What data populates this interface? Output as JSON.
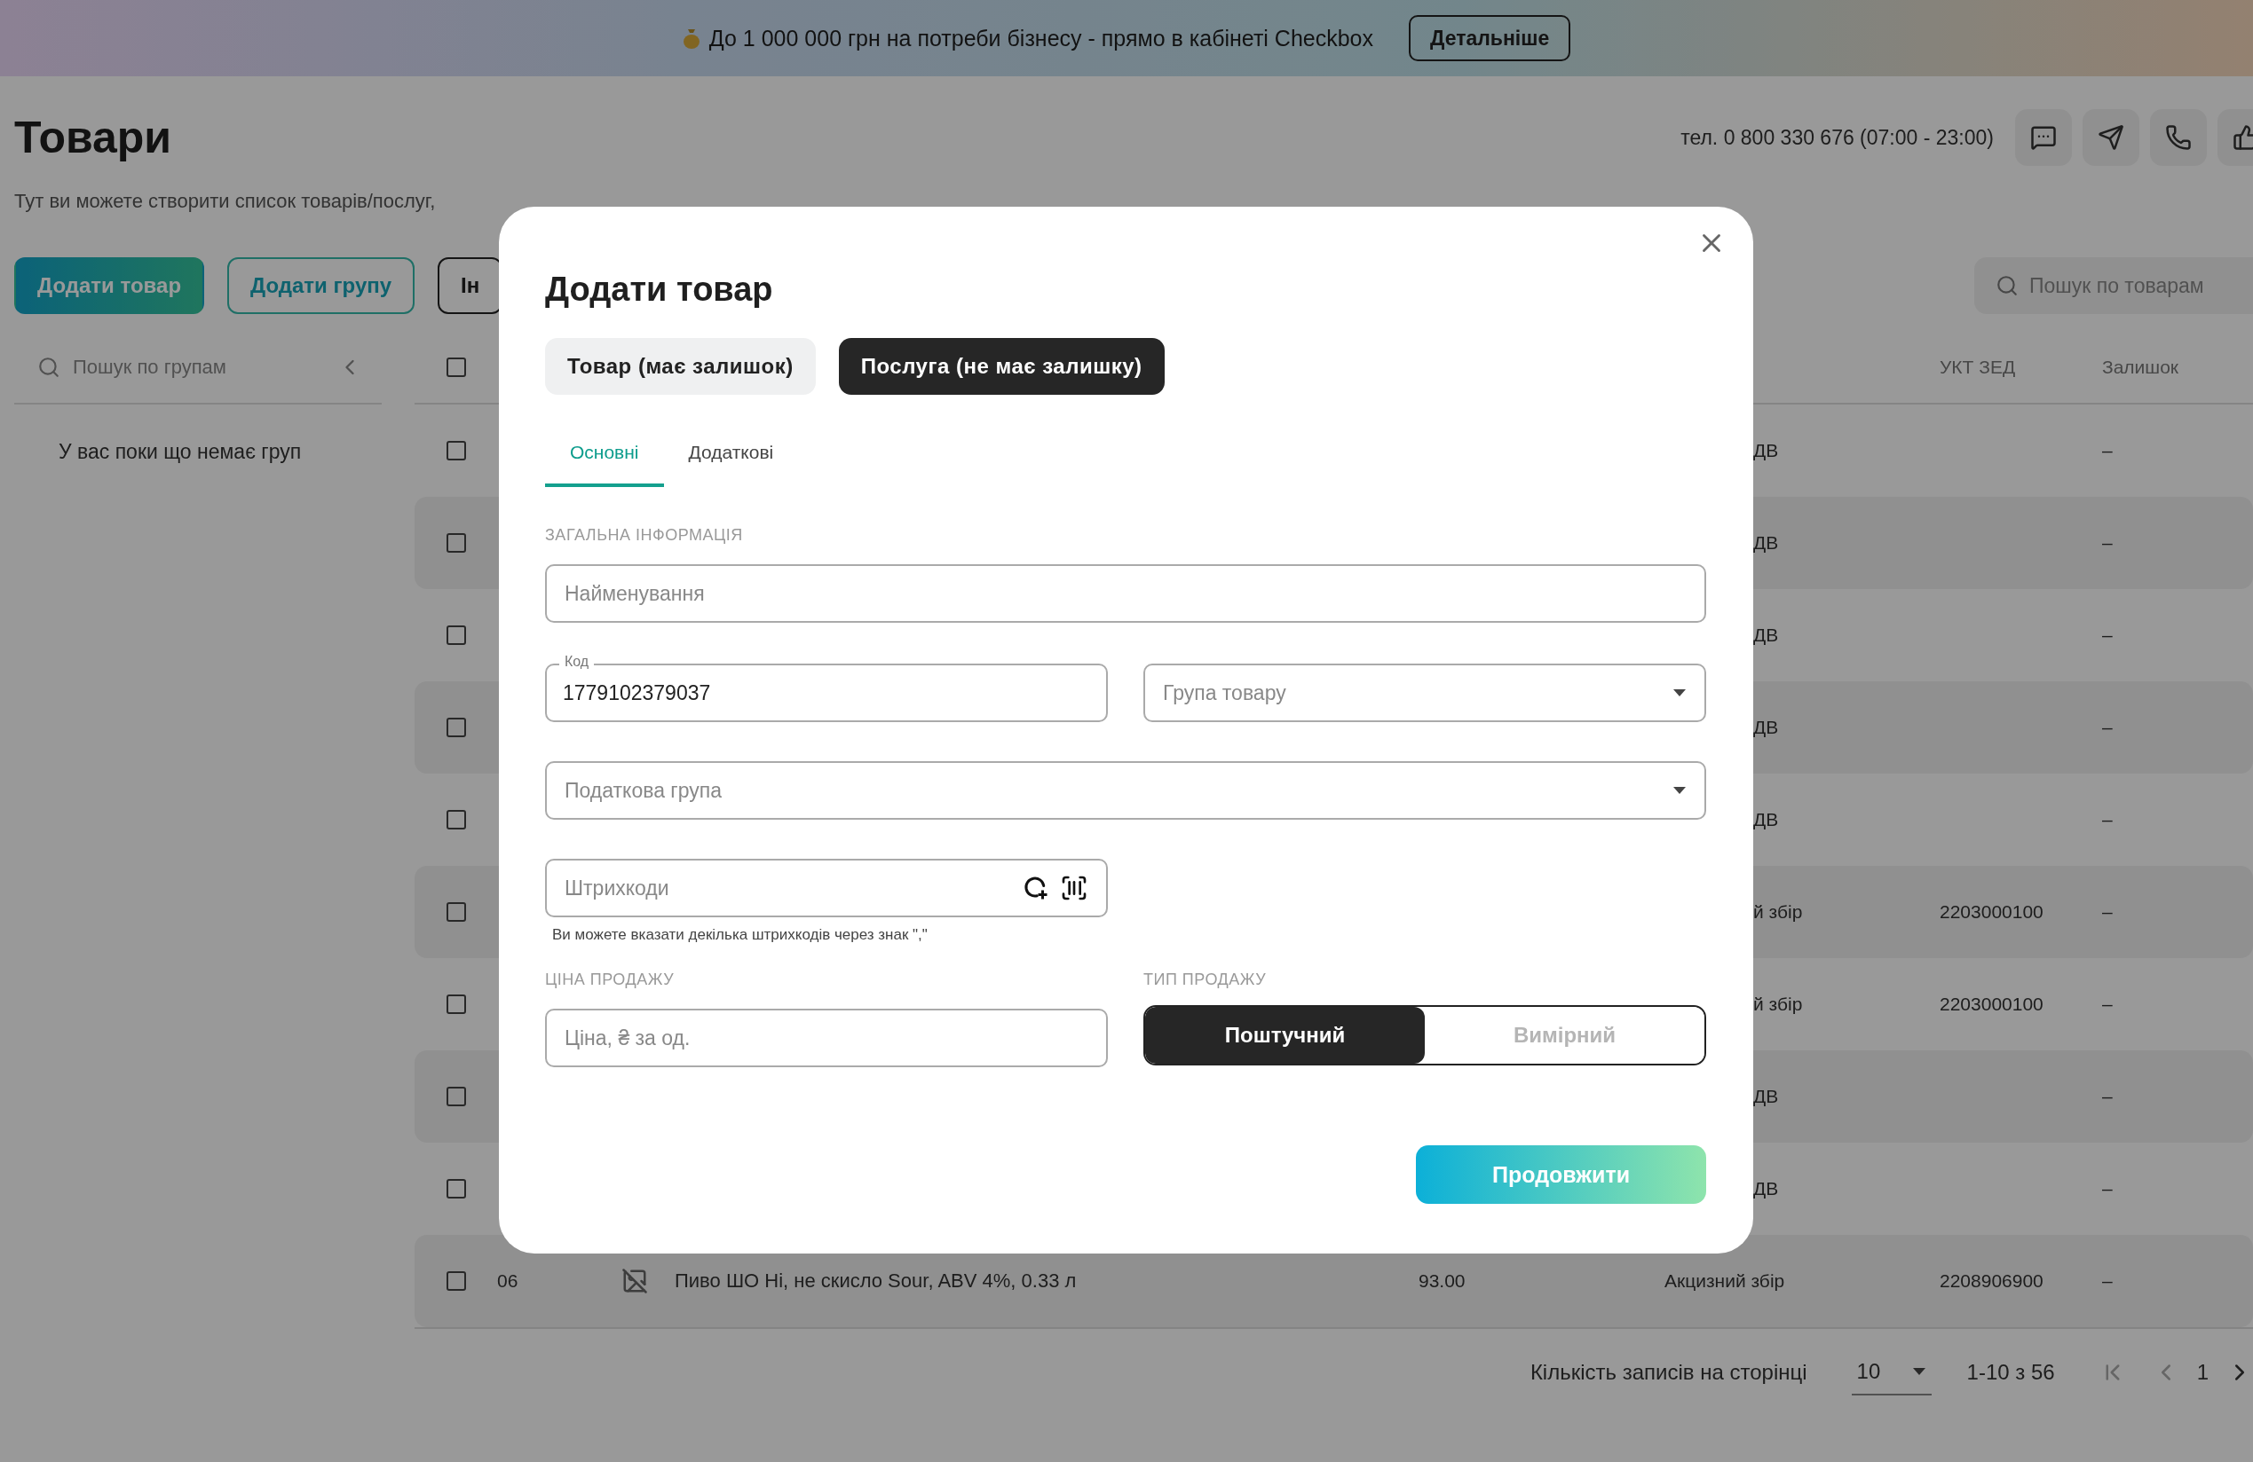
{
  "banner": {
    "text": "До 1 000 000 грн на потреби бізнесу - прямо в кабінеті Checkbox",
    "button": "Детальніше"
  },
  "header": {
    "title": "Товари",
    "phone": "тел. 0 800 330 676 (07:00 - 23:00)",
    "subtitle": "Тут ви можете створити список товарів/послуг,"
  },
  "actions": [
    {
      "label": "Додати товар",
      "kind": "primary"
    },
    {
      "label": "Додати групу",
      "kind": "outline"
    },
    {
      "label": "Ін",
      "kind": "dark"
    }
  ],
  "product_search": {
    "placeholder": "Пошук по товарам"
  },
  "sidebar": {
    "search_placeholder": "Пошук по групам",
    "empty_text": "У вас поки що немає груп"
  },
  "table": {
    "header_checked": false,
    "columns": [
      {
        "label": "УКТ ЗЕД"
      },
      {
        "label": "Залишок"
      }
    ],
    "rows": [
      {
        "kind": "covered",
        "checked": false,
        "tax": "ДВ",
        "stock": "–"
      },
      {
        "kind": "covered",
        "checked": false,
        "tax": "ДВ",
        "stock": "–"
      },
      {
        "kind": "covered",
        "checked": false,
        "tax": "ДВ",
        "stock": "–"
      },
      {
        "kind": "covered",
        "checked": false,
        "tax": "ДВ",
        "stock": "–"
      },
      {
        "kind": "covered",
        "checked": false,
        "tax": "ДВ",
        "stock": "–"
      },
      {
        "kind": "covered",
        "checked": false,
        "tax": "й збір",
        "ukt": "2203000100",
        "stock": "–"
      },
      {
        "kind": "covered",
        "checked": false,
        "tax": "й збір",
        "ukt": "2203000100",
        "stock": "–"
      },
      {
        "kind": "covered",
        "checked": false,
        "tax": "ДВ",
        "stock": "–"
      },
      {
        "kind": "covered",
        "checked": false,
        "tax": "ДВ",
        "stock": "–"
      },
      {
        "kind": "full",
        "checked": false,
        "code": "06",
        "name": "Пиво ШО Ні, не скисло Sour, ABV 4%, 0.33 л",
        "price": "93.00",
        "tax": "Акцизний збір",
        "ukt": "2208906900",
        "stock": "–"
      }
    ]
  },
  "pagination": {
    "rows_label": "Кількість записів на сторінці",
    "page_size": "10",
    "range": "1-10 з 56",
    "page": "1"
  },
  "modal": {
    "title": "Додати товар",
    "type_options": [
      {
        "label": "Товар (має залишок)",
        "selected": false
      },
      {
        "label": "Послуга (не має залишку)",
        "selected": true
      }
    ],
    "tabs": [
      {
        "label": "Основні",
        "selected": true
      },
      {
        "label": "Додаткові",
        "selected": false
      }
    ],
    "general_section": "ЗАГАЛЬНА ІНФОРМАЦІЯ",
    "name_field": {
      "placeholder": "Найменування"
    },
    "code_field": {
      "label": "Код",
      "value": "1779102379037"
    },
    "group_select": {
      "placeholder": "Група товару"
    },
    "tax_select": {
      "placeholder": "Податкова група"
    },
    "barcode_field": {
      "placeholder": "Штрихкоди",
      "hint": "Ви можете вказати декілька штрихкодів через знак \",\""
    },
    "price_section": "ЦІНА ПРОДАЖУ",
    "price_field": {
      "placeholder": "Ціна, ₴ за од."
    },
    "sale_type_section": "ТИП ПРОДАЖУ",
    "sale_types": [
      {
        "label": "Поштучний",
        "selected": true
      },
      {
        "label": "Вимірний",
        "selected": false
      }
    ],
    "continue_button": "Продовжити"
  }
}
